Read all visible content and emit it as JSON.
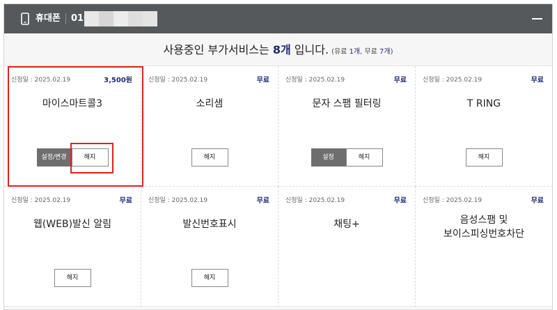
{
  "header": {
    "label": "휴대폰",
    "number_prefix": "010",
    "icon": "phone-icon",
    "collapse_icon": "minus-icon",
    "mask_colors": [
      "#e8e8e8",
      "#d6d6d6",
      "#ececec",
      "#dedede",
      "#e4e4e4"
    ]
  },
  "summary": {
    "prefix": "사용중인 부가서비스는 ",
    "count": "8개",
    "suffix": " 입니다.",
    "detail_open": "(유료 ",
    "paid_count": "1개",
    "detail_mid": ", 무료 ",
    "free_count": "7개",
    "detail_close": ")"
  },
  "cards": [
    {
      "date": "신청일 : 2025.02.19",
      "price": "3,500원",
      "name": "마이스마트콜3",
      "setting_label": "설정/변경",
      "cancel_label": "해지"
    },
    {
      "date": "신청일 : 2025.02.19",
      "price": "무료",
      "name": "소리샘",
      "cancel_label": "해지"
    },
    {
      "date": "신청일 : 2025.02.19",
      "price": "무료",
      "name": "문자 스팸 필터링",
      "setting_label": "설정",
      "cancel_label": "해지"
    },
    {
      "date": "신청일 : 2025.02.19",
      "price": "무료",
      "name": "T RING",
      "cancel_label": "해지"
    },
    {
      "date": "신청일 : 2025.02.19",
      "price": "무료",
      "name": "웹(WEB)발신 알림",
      "cancel_label": "해지"
    },
    {
      "date": "신청일 : 2025.02.19",
      "price": "무료",
      "name": "발신번호표시",
      "cancel_label": "해지"
    },
    {
      "date": "신청일 : 2025.02.19",
      "price": "무료",
      "name": "채팅+"
    },
    {
      "date": "신청일 : 2025.02.19",
      "price": "무료",
      "name_line1": "음성스팸 및",
      "name_line2": "보이스피싱번호차단"
    }
  ],
  "colors": {
    "header_bg": "#55595c",
    "accent_navy": "#1f2a7a",
    "highlight_red": "#e02020",
    "setting_button_bg": "#6e6e6e"
  }
}
